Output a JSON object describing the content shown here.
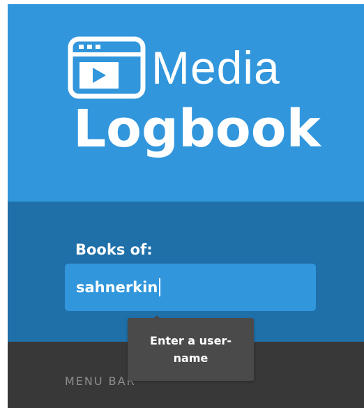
{
  "app": {
    "logo": {
      "icon": "video-window-icon",
      "line1": "Media",
      "line2": "Logbook"
    },
    "form": {
      "label": "Books of:",
      "username_value": "sahnerkin",
      "tooltip": "Enter a user-name"
    },
    "menu_bar": {
      "label": "MENU BAR"
    }
  },
  "colors": {
    "header_blue": "#3196dc",
    "form_blue": "#1f6fa9",
    "input_blue": "#3196dc",
    "menu_bar_dark": "#383838",
    "tooltip_bg": "#4a4a4a",
    "menu_label_gray": "#8e8e8e"
  }
}
